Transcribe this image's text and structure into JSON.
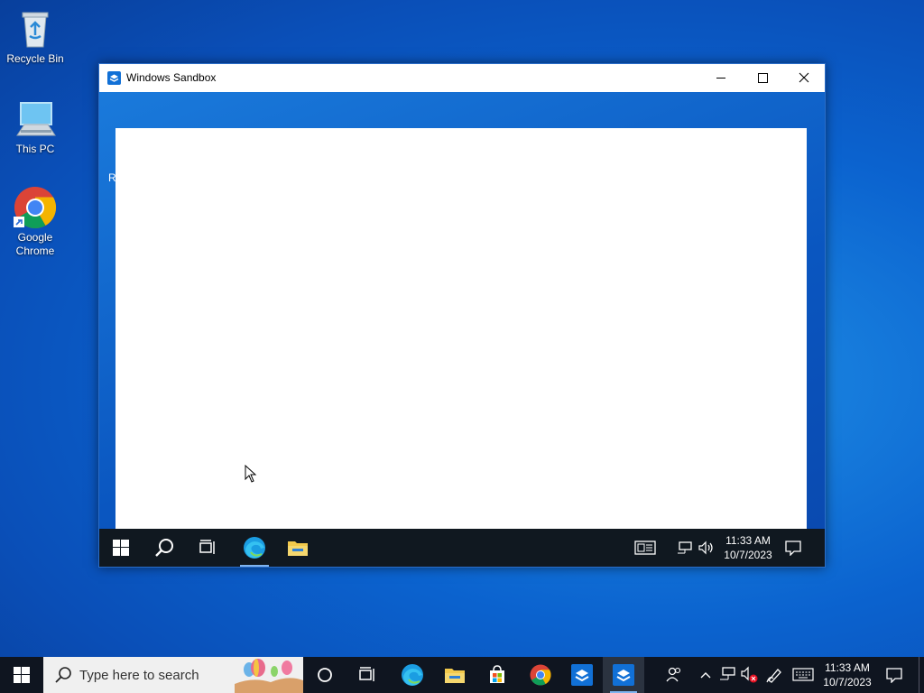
{
  "desktop": {
    "icons": [
      {
        "label": "Recycle Bin",
        "icon": "recycle-bin-icon"
      },
      {
        "label": "This PC",
        "icon": "this-pc-icon"
      },
      {
        "label": "Google Chrome",
        "icon": "chrome-icon"
      }
    ]
  },
  "sandbox_window": {
    "title": "Windows Sandbox",
    "peek_text": "R",
    "inner_taskbar": {
      "items": [
        "start-icon",
        "search-icon",
        "task-view-icon",
        "edge-icon",
        "file-explorer-icon"
      ],
      "time": "11:33 AM",
      "date": "10/7/2023"
    }
  },
  "taskbar": {
    "search_placeholder": "Type here to search",
    "pinned": [
      "cortana-icon",
      "task-view-icon",
      "edge-icon",
      "file-explorer-icon",
      "store-icon",
      "chrome-icon",
      "sandbox-icon",
      "sandbox-icon-active"
    ],
    "time": "11:33 AM",
    "date": "10/7/2023"
  },
  "colors": {
    "desktop_bg": "#0b63cf",
    "taskbar_bg": "#0f1520",
    "accent": "#7fb4f0"
  }
}
